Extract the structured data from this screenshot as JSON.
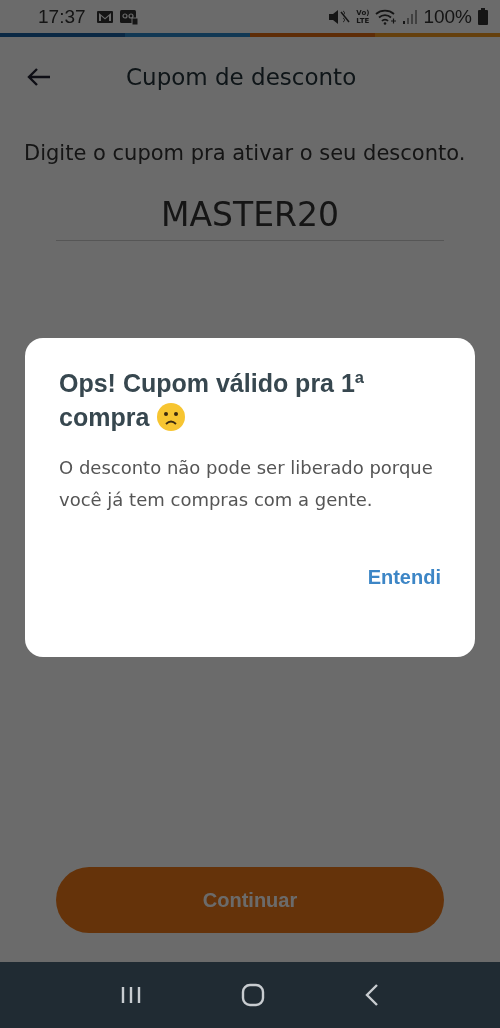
{
  "status_bar": {
    "time": "17:37",
    "volte": [
      "Vo)",
      "LTE"
    ],
    "battery": "100%"
  },
  "app_bar": {
    "title": "Cupom de desconto"
  },
  "instruction": "Digite o cupom pra ativar o seu desconto.",
  "coupon_field": {
    "value": "MASTER20"
  },
  "primary_button": {
    "label": "Continuar"
  },
  "dialog": {
    "title": "Ops! Cupom válido pra 1ª compra",
    "body": "O desconto não pode ser liberado porque você já tem compras com a gente.",
    "action": "Entendi"
  }
}
